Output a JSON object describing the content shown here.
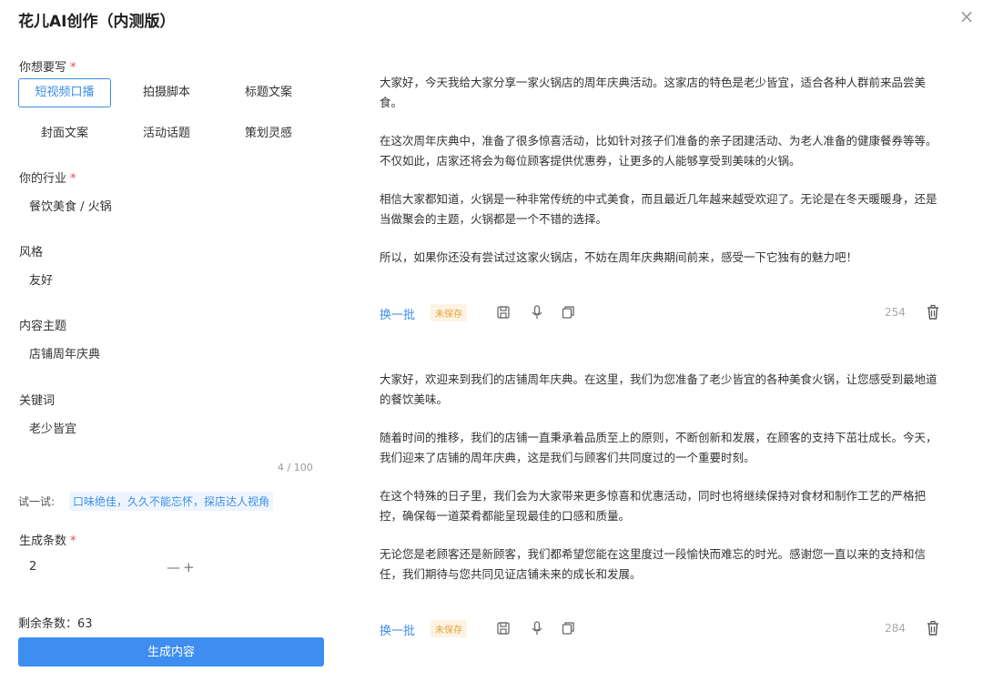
{
  "window": {
    "title": "花儿AI创作（内测版）",
    "close_symbol": "×"
  },
  "form": {
    "write_type": {
      "label": "你想要写",
      "required_mark": "*",
      "options": [
        {
          "label": "短视频口播",
          "selected": true
        },
        {
          "label": "拍摄脚本",
          "selected": false
        },
        {
          "label": "标题文案",
          "selected": false
        },
        {
          "label": "封面文案",
          "selected": false
        },
        {
          "label": "活动话题",
          "selected": false
        },
        {
          "label": "策划灵感",
          "selected": false
        }
      ]
    },
    "industry": {
      "label": "你的行业",
      "required_mark": "*",
      "value": "餐饮美食 / 火锅"
    },
    "style": {
      "label": "风格",
      "value": "友好"
    },
    "topic": {
      "label": "内容主题",
      "value": "店铺周年庆典"
    },
    "keywords": {
      "label": "关键词",
      "value": "老少皆宜",
      "counter": "4 / 100"
    },
    "try": {
      "label": "试一试:",
      "suggestion": "口味绝佳，久久不能忘怀，探店达人视角"
    },
    "count": {
      "label": "生成条数",
      "required_mark": "*",
      "value": "2",
      "minus": "—",
      "plus": "+"
    },
    "remaining": "剩余条数：63",
    "generate_label": "生成内容"
  },
  "results": [
    {
      "paragraphs": [
        "大家好，今天我给大家分享一家火锅店的周年庆典活动。这家店的特色是老少皆宜，适合各种人群前来品尝美食。",
        "在这次周年庆典中，准备了很多惊喜活动，比如针对孩子们准备的亲子团建活动、为老人准备的健康餐券等等。不仅如此，店家还将会为每位顾客提供优惠券，让更多的人能够享受到美味的火锅。",
        "相信大家都知道，火锅是一种非常传统的中式美食，而且最近几年越来越受欢迎了。无论是在冬天暖暖身，还是当做聚会的主题，火锅都是一个不错的选择。",
        "所以，如果你还没有尝试过这家火锅店，不妨在周年庆典期间前来，感受一下它独有的魅力吧！"
      ],
      "refresh_label": "换一批",
      "status": "未保存",
      "word_count": "254"
    },
    {
      "paragraphs": [
        "大家好，欢迎来到我们的店铺周年庆典。在这里，我们为您准备了老少皆宜的各种美食火锅，让您感受到最地道的餐饮美味。",
        "随着时间的推移，我们的店铺一直秉承着品质至上的原则，不断创新和发展，在顾客的支持下茁壮成长。今天，我们迎来了店铺的周年庆典，这是我们与顾客们共同度过的一个重要时刻。",
        "在这个特殊的日子里，我们会为大家带来更多惊喜和优惠活动，同时也将继续保持对食材和制作工艺的严格把控，确保每一道菜肴都能呈现最佳的口感和质量。",
        "无论您是老顾客还是新顾客，我们都希望您能在这里度过一段愉快而难忘的时光。感谢您一直以来的支持和信任，我们期待与您共同见证店铺未来的成长和发展。"
      ],
      "refresh_label": "换一批",
      "status": "未保存",
      "word_count": "284"
    }
  ],
  "colors": {
    "accent": "#3b8eea",
    "primary_button": "#3d8ef0",
    "required": "#e5484d",
    "unsaved_text": "#e8a33d",
    "unsaved_bg": "#fdf3e2"
  },
  "icons": [
    "close-icon",
    "save-icon",
    "microphone-icon",
    "copy-icon",
    "trash-icon"
  ]
}
